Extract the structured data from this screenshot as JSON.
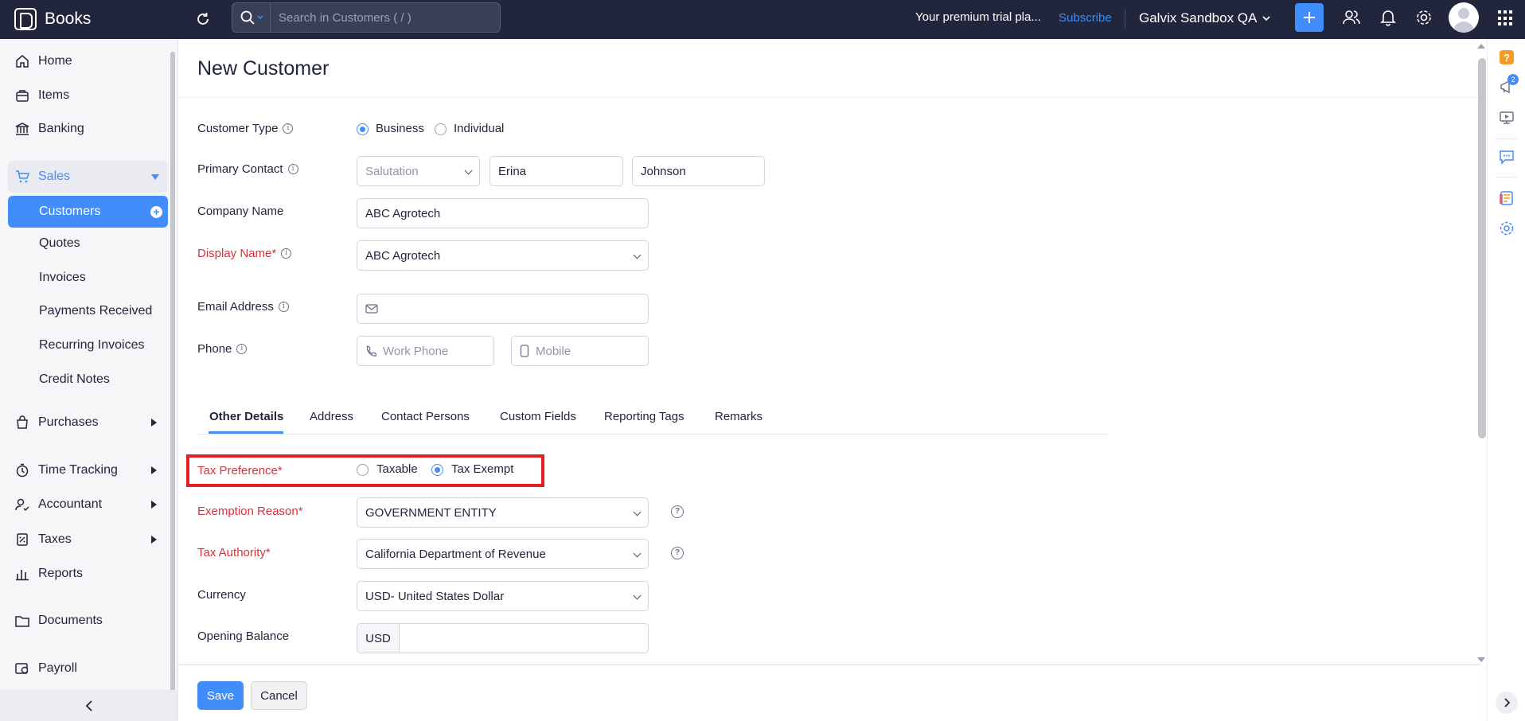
{
  "app": {
    "name": "Books"
  },
  "topbar": {
    "search_placeholder": "Search in Customers ( / )",
    "trial_text": "Your premium trial pla...",
    "subscribe_label": "Subscribe",
    "org_name": "Galvix Sandbox QA"
  },
  "sidebar": {
    "home": "Home",
    "items": "Items",
    "banking": "Banking",
    "sales": "Sales",
    "sales_sub": {
      "customers": "Customers",
      "quotes": "Quotes",
      "invoices": "Invoices",
      "payments_received": "Payments Received",
      "recurring_invoices": "Recurring Invoices",
      "credit_notes": "Credit Notes"
    },
    "purchases": "Purchases",
    "time_tracking": "Time Tracking",
    "accountant": "Accountant",
    "taxes": "Taxes",
    "reports": "Reports",
    "documents": "Documents",
    "payroll": "Payroll"
  },
  "page": {
    "title": "New Customer"
  },
  "form": {
    "customer_type": {
      "label": "Customer Type",
      "options": [
        "Business",
        "Individual"
      ],
      "selected": "Business"
    },
    "primary_contact": {
      "label": "Primary Contact",
      "salutation_placeholder": "Salutation",
      "first_name": "Erina",
      "last_name": "Johnson"
    },
    "company_name": {
      "label": "Company Name",
      "value": "ABC Agrotech"
    },
    "display_name": {
      "label": "Display Name*",
      "value": "ABC Agrotech"
    },
    "email": {
      "label": "Email Address",
      "value": ""
    },
    "phone": {
      "label": "Phone",
      "work_placeholder": "Work Phone",
      "mobile_placeholder": "Mobile"
    }
  },
  "tabs": [
    "Other Details",
    "Address",
    "Contact Persons",
    "Custom Fields",
    "Reporting Tags",
    "Remarks"
  ],
  "other_details": {
    "tax_preference": {
      "label": "Tax Preference*",
      "options": [
        "Taxable",
        "Tax Exempt"
      ],
      "selected": "Tax Exempt"
    },
    "exemption_reason": {
      "label": "Exemption Reason*",
      "value": "GOVERNMENT ENTITY"
    },
    "tax_authority": {
      "label": "Tax Authority*",
      "value": "California Department of Revenue"
    },
    "currency": {
      "label": "Currency",
      "value": "USD- United States Dollar"
    },
    "opening_balance": {
      "label": "Opening Balance",
      "currency_code": "USD",
      "value": ""
    }
  },
  "footer": {
    "save_label": "Save",
    "cancel_label": "Cancel"
  },
  "rail": {
    "notification_count": "2"
  },
  "colors": {
    "topbar": "#21263c",
    "accent": "#408dfb",
    "required": "#d6323d",
    "highlight": "#e02020"
  }
}
